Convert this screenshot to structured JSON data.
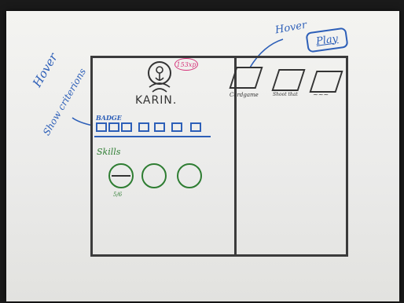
{
  "hover_left": "Hover",
  "show_criterions": "Show criterions",
  "hover_right": "Hover",
  "play_label": "Play",
  "profile": {
    "name": "KARIN.",
    "xp": "153xp"
  },
  "badge": {
    "label": "BADGE",
    "count": 7
  },
  "skills": {
    "label": "Skills",
    "items": [
      {
        "value": "5/6",
        "active": true
      },
      {
        "value": "",
        "active": false
      },
      {
        "value": "",
        "active": false
      }
    ]
  },
  "games": [
    {
      "label": "Cardgame"
    },
    {
      "label": "Shoot that"
    },
    {
      "label": "~~~"
    }
  ]
}
